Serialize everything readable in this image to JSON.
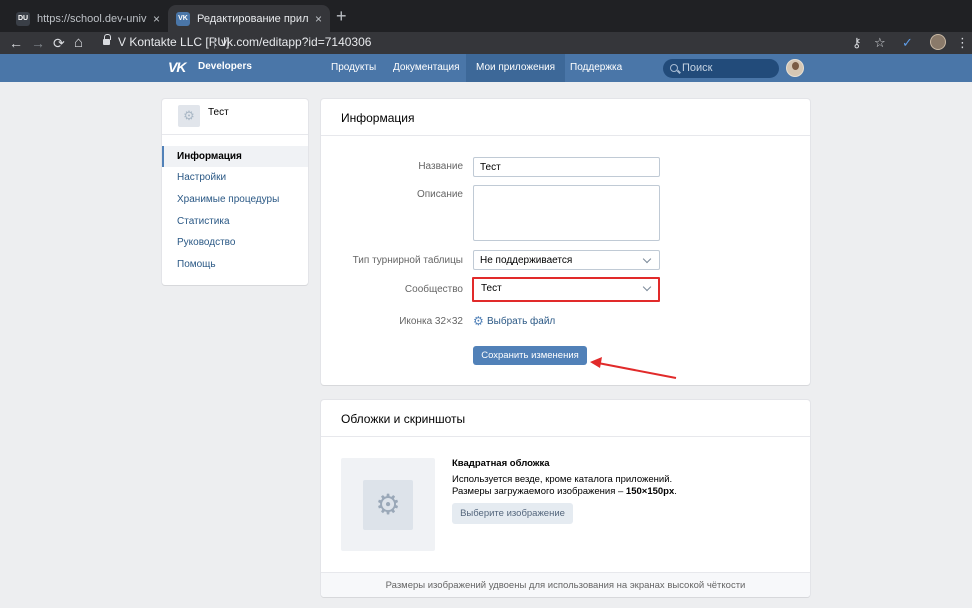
{
  "browser": {
    "tabs": [
      {
        "title": "https://school.dev-university.ru/",
        "favicon": "DU",
        "close": "×"
      },
      {
        "title": "Редактирование приложения",
        "favicon": "VK",
        "close": "×"
      }
    ],
    "new_tab": "+",
    "site_identity": "V Kontakte LLC [RU]",
    "url": "vk.com/editapp?id=7140306",
    "icons": {
      "back": "←",
      "forward": "→",
      "reload": "⟳",
      "home": "⌂",
      "key": "⚷",
      "star": "☆",
      "check": "✓",
      "menu": "⋮"
    }
  },
  "vk_header": {
    "logo": "VK",
    "brand": "Developers",
    "menu": [
      "Продукты",
      "Документация",
      "Мои приложения",
      "Поддержка"
    ],
    "active_menu": "Мои приложения",
    "search_placeholder": "Поиск"
  },
  "sidebar": {
    "app_name": "Тест",
    "items": [
      "Информация",
      "Настройки",
      "Хранимые процедуры",
      "Статистика",
      "Руководство",
      "Помощь"
    ],
    "active": "Информация"
  },
  "info": {
    "title": "Информация",
    "name_label": "Название",
    "name_value": "Тест",
    "description_label": "Описание",
    "description_value": "",
    "leaderboard_label": "Тип турнирной таблицы",
    "leaderboard_value": "Не поддерживается",
    "community_label": "Сообщество",
    "community_value": "Тест",
    "icon_label": "Иконка 32×32",
    "choose_file": "Выбрать файл",
    "save_button": "Сохранить изменения"
  },
  "covers": {
    "title": "Обложки и скриншоты",
    "cover_title": "Квадратная обложка",
    "cover_line1": "Используется везде, кроме каталога приложений.",
    "cover_line2_prefix": "Размеры загружаемого изображения – ",
    "cover_line2_size": "150×150px",
    "cover_line2_suffix": ".",
    "choose_image": "Выберите изображение",
    "footer": "Размеры изображений удвоены для использования на экранах высокой чёткости"
  },
  "colors": {
    "vk_blue": "#4a76a8",
    "highlight_red": "#e12a2a",
    "link": "#2a5885"
  }
}
